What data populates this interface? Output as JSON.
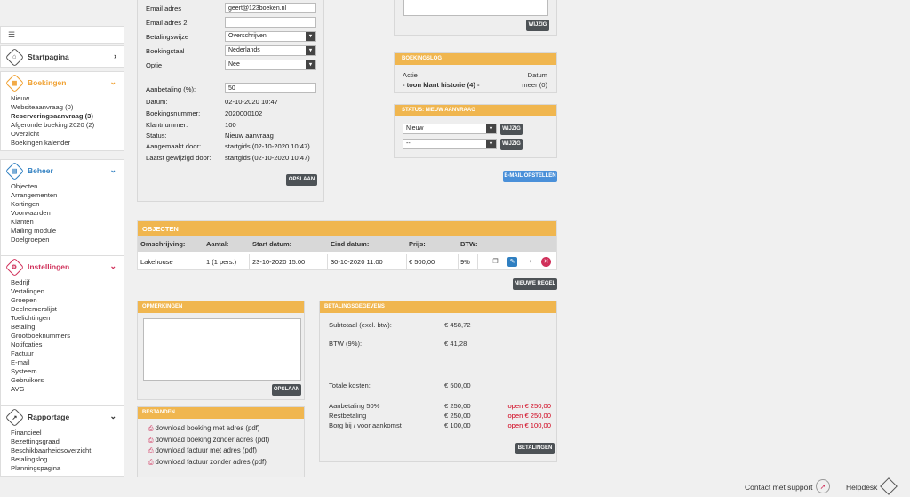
{
  "sidebar": {
    "collapse_icon": "menu-collapse-icon",
    "start": {
      "label": "Startpagina"
    },
    "boekingen": {
      "label": "Boekingen",
      "items": [
        "Nieuw",
        "Websiteaanvraag (0)",
        "Reserveringsaanvraag (3)",
        "Afgeronde boeking 2020 (2)",
        "Overzicht",
        "Boekingen kalender"
      ]
    },
    "beheer": {
      "label": "Beheer",
      "items": [
        "Objecten",
        "Arrangementen",
        "Kortingen",
        "Voorwaarden",
        "Klanten",
        "Mailing module",
        "Doelgroepen"
      ]
    },
    "instellingen": {
      "label": "Instellingen",
      "items": [
        "Bedrijf",
        "Vertalingen",
        "Groepen",
        "Deelnemerslijst",
        "Toelichtingen",
        "Betaling",
        "Grootboeknummers",
        "Notifcaties",
        "Factuur",
        "E-mail",
        "Systeem",
        "Gebruikers",
        "AVG"
      ]
    },
    "rapportage": {
      "label": "Rapportage",
      "items": [
        "Financieel",
        "Bezettingsgraad",
        "Beschikbaarheidsoverzicht",
        "Betalingslog",
        "Planningspagina"
      ]
    }
  },
  "form": {
    "email_label": "Email adres",
    "email_value": "geert@123boeken.nl",
    "email2_label": "Email adres 2",
    "email2_value": "",
    "betalingswijze_label": "Betalingswijze",
    "betalingswijze_value": "Overschrijven",
    "boekingstaal_label": "Boekingstaal",
    "boekingstaal_value": "Nederlands",
    "optie_label": "Optie",
    "optie_value": "Nee",
    "aanbetaling_label": "Aanbetaling (%):",
    "aanbetaling_value": "50",
    "datum_label": "Datum:",
    "datum_value": "02-10-2020 10:47",
    "boekingsnummer_label": "Boekingsnummer:",
    "boekingsnummer_value": "2020000102",
    "klantnummer_label": "Klantnummer:",
    "klantnummer_value": "100",
    "status_label": "Status:",
    "status_value": "Nieuw aanvraag",
    "aangemaakt_label": "Aangemaakt door:",
    "aangemaakt_value": "startgids (02-10-2020 10:47)",
    "gewijzigd_label": "Laatst gewijzigd door:",
    "gewijzigd_value": "startgids (02-10-2020 10:47)",
    "save_button": "OPSLAAN"
  },
  "top_right": {
    "wijzig_button": "WIJZIG"
  },
  "boekingslog": {
    "title": "BOEKINGSLOG",
    "col_actie": "Actie",
    "col_datum": "Datum",
    "row_label": "- toon klant historie (4) -",
    "row_value": "meer (0)"
  },
  "status_panel": {
    "title": "STATUS: NIEUW AANVRAAG",
    "select1": "Nieuw",
    "select2": "--",
    "wijzig1": "WIJZIG",
    "wijzig2": "WIJZIG"
  },
  "email_button": "E-MAIL OPSTELLEN",
  "objecten": {
    "title": "OBJECTEN",
    "headers": [
      "Omschrijving:",
      "Aantal:",
      "Start datum:",
      "Eind datum:",
      "Prijs:",
      "BTW:"
    ],
    "rows": [
      [
        "Lakehouse",
        "1 (1 pers.)",
        "23-10-2020 15:00",
        "30-10-2020 11:00",
        "€ 500,00",
        "9%"
      ]
    ],
    "new_row_button": "NIEUWE REGEL"
  },
  "opmerkingen": {
    "title": "OPMERKINGEN",
    "save_button": "OPSLAAN"
  },
  "bestanden": {
    "title": "BESTANDEN",
    "files": [
      "download boeking met adres (pdf)",
      "download boeking zonder adres (pdf)",
      "download factuur met adres (pdf)",
      "download factuur zonder adres (pdf)"
    ]
  },
  "betaling": {
    "title": "BETALINGSGEGEVENS",
    "subtotaal_label": "Subtotaal (excl. btw):",
    "subtotaal_value": "€ 458,72",
    "btw_label": "BTW (9%):",
    "btw_value": "€ 41,28",
    "totaal_label": "Totale kosten:",
    "totaal_value": "€ 500,00",
    "rows": [
      {
        "label": "Aanbetaling 50%",
        "value": "€ 250,00",
        "open": "open € 250,00"
      },
      {
        "label": "Restbetaling",
        "value": "€ 250,00",
        "open": "open € 250,00"
      },
      {
        "label": "Borg bij / voor aankomst",
        "value": "€ 100,00",
        "open": "open € 100,00"
      }
    ],
    "betalingen_button": "BETALINGEN"
  },
  "footer": {
    "contact": "Contact met support",
    "helpdesk": "Helpdesk"
  },
  "colors": {
    "accent": "#f0b64f",
    "boekingen": "#f0a030",
    "beheer": "#2f7fc1",
    "instellingen": "#d0305a",
    "danger": "#d0021b"
  }
}
